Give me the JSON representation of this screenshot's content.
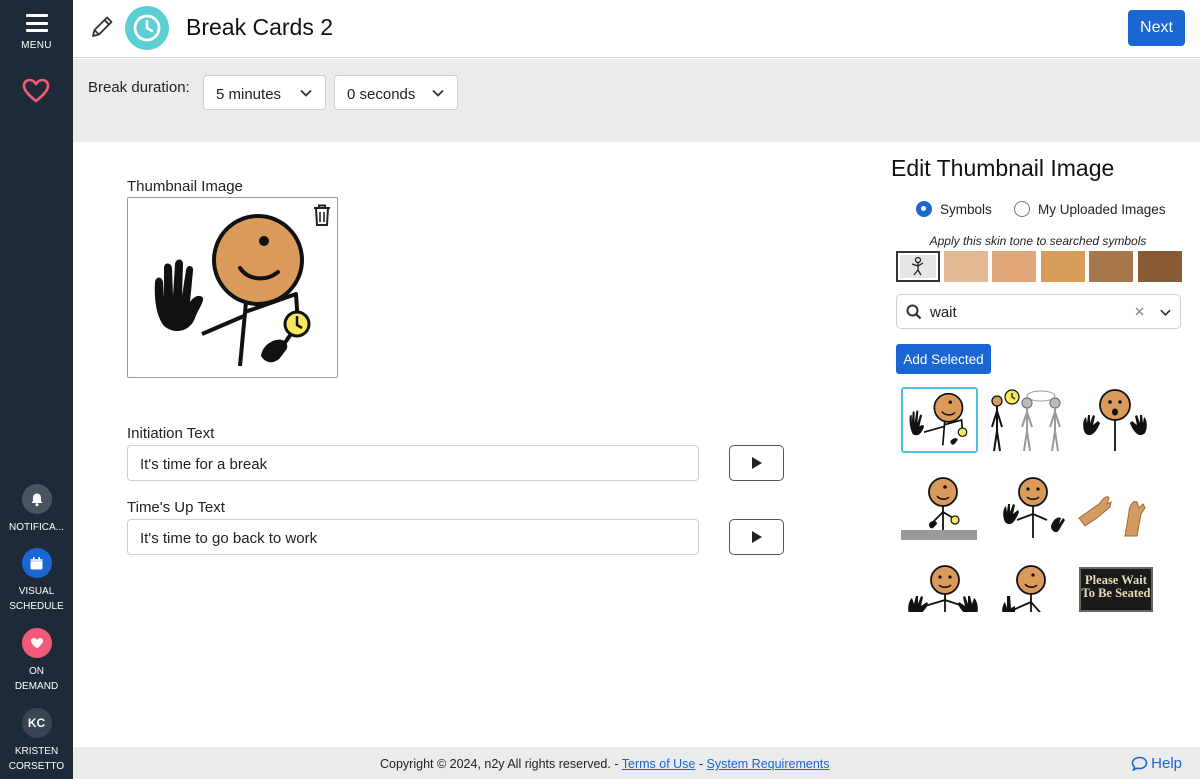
{
  "sidebar": {
    "menu_label": "MENU",
    "notifications_label": "NOTIFICA...",
    "visual_schedule_label": "VISUAL SCHEDULE",
    "on_demand_label": "ON DEMAND",
    "user_initials": "KC",
    "user_name": "KRISTEN CORSETTO"
  },
  "header": {
    "title": "Break Cards 2",
    "next_label": "Next"
  },
  "duration": {
    "label": "Break duration:",
    "minutes": "5 minutes",
    "seconds": "0 seconds"
  },
  "form": {
    "thumbnail_label": "Thumbnail Image",
    "initiation_label": "Initiation Text",
    "initiation_value": "It's time for a break",
    "timesup_label": "Time's Up Text",
    "timesup_value": "It's time to go back to work"
  },
  "panel": {
    "title": "Edit Thumbnail Image",
    "radio_symbols": "Symbols",
    "radio_uploaded": "My Uploaded Images",
    "selected_radio": "Symbols",
    "skin_caption": "Apply this skin tone to searched symbols",
    "skin_tones": [
      "#e2b994",
      "#e0a77a",
      "#d69c5a",
      "#a8774c",
      "#8a5a35"
    ],
    "search_value": "wait",
    "add_selected_label": "Add Selected",
    "wait_sign_text": "Please Wait To Be Seated"
  },
  "footer": {
    "copyright": "Copyright © 2024, n2y All rights reserved. -",
    "terms_link": "Terms of Use",
    "separator": "-",
    "requirements_link": "System Requirements",
    "help_label": "Help"
  },
  "colors": {
    "sidebar_bg": "#1e2a38",
    "accent": "#1a66d2",
    "clock": "#5bcfd3",
    "heart": "#f15b78"
  }
}
